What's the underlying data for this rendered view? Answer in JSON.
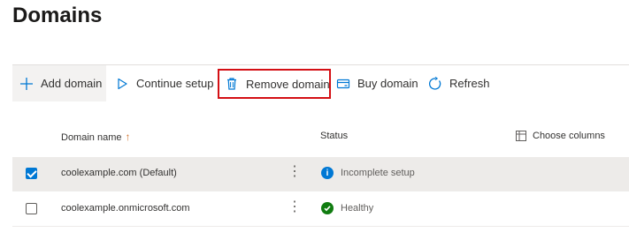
{
  "page": {
    "title": "Domains"
  },
  "toolbar": {
    "add_label": "Add domain",
    "continue_label": "Continue setup",
    "remove_label": "Remove domain",
    "buy_label": "Buy domain",
    "refresh_label": "Refresh",
    "highlight_color": "#d40f14"
  },
  "table": {
    "columns": {
      "name": "Domain name",
      "status": "Status",
      "choose": "Choose columns"
    },
    "sort_arrow": "↑",
    "rows": [
      {
        "domain": "coolexample.com (Default)",
        "status": "Incomplete setup",
        "status_icon": "info-icon",
        "selected": true
      },
      {
        "domain": "coolexample.onmicrosoft.com",
        "status": "Healthy",
        "status_icon": "check-circle-icon",
        "selected": false
      }
    ],
    "more_glyph": "⋮"
  }
}
